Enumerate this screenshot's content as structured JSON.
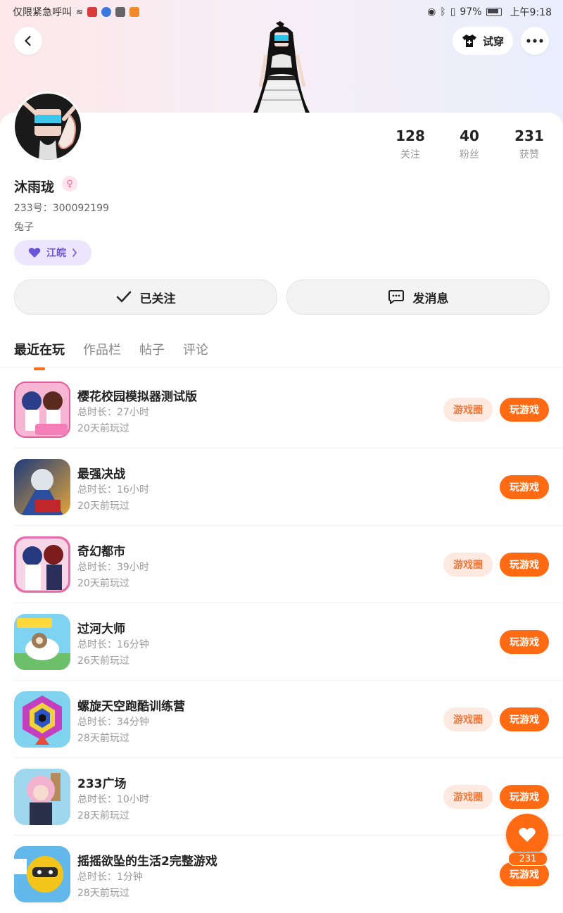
{
  "status_bar": {
    "carrier": "仅限紧急呼叫",
    "battery": "97%",
    "time": "上午9:18"
  },
  "header": {
    "tryon_label": "试穿"
  },
  "profile": {
    "name": "沐雨珑",
    "uid": "233号：300092199",
    "bio": "兔子",
    "region": "江皖",
    "stats": [
      {
        "num": "128",
        "label": "关注"
      },
      {
        "num": "40",
        "label": "粉丝"
      },
      {
        "num": "231",
        "label": "获赞"
      }
    ]
  },
  "actions": {
    "followed_label": "已关注",
    "message_label": "发消息"
  },
  "tabs": [
    "最近在玩",
    "作品栏",
    "帖子",
    "评论"
  ],
  "games": [
    {
      "name": "樱花校园模拟器测试版",
      "duration": "总时长：27小时",
      "last": "20天前玩过",
      "circle": "游戏圈",
      "play": "玩游戏"
    },
    {
      "name": "最强决战",
      "duration": "总时长：16小时",
      "last": "20天前玩过",
      "circle": "",
      "play": "玩游戏"
    },
    {
      "name": "奇幻都市",
      "duration": "总时长：39小时",
      "last": "20天前玩过",
      "circle": "游戏圈",
      "play": "玩游戏"
    },
    {
      "name": "过河大师",
      "duration": "总时长：16分钟",
      "last": "26天前玩过",
      "circle": "",
      "play": "玩游戏"
    },
    {
      "name": "螺旋天空跑酷训练营",
      "duration": "总时长：34分钟",
      "last": "28天前玩过",
      "circle": "游戏圈",
      "play": "玩游戏"
    },
    {
      "name": "233广场",
      "duration": "总时长：10小时",
      "last": "28天前玩过",
      "circle": "游戏圈",
      "play": "玩游戏"
    },
    {
      "name": "摇摇欲坠的生活2完整游戏",
      "duration": "总时长：1分钟",
      "last": "28天前玩过",
      "circle": "",
      "play": "玩游戏"
    }
  ],
  "like_fab": {
    "count": "231"
  },
  "colors": {
    "accent": "#ff6a13",
    "circle_bg": "#fde9df",
    "region_bg": "#ece6fd"
  }
}
